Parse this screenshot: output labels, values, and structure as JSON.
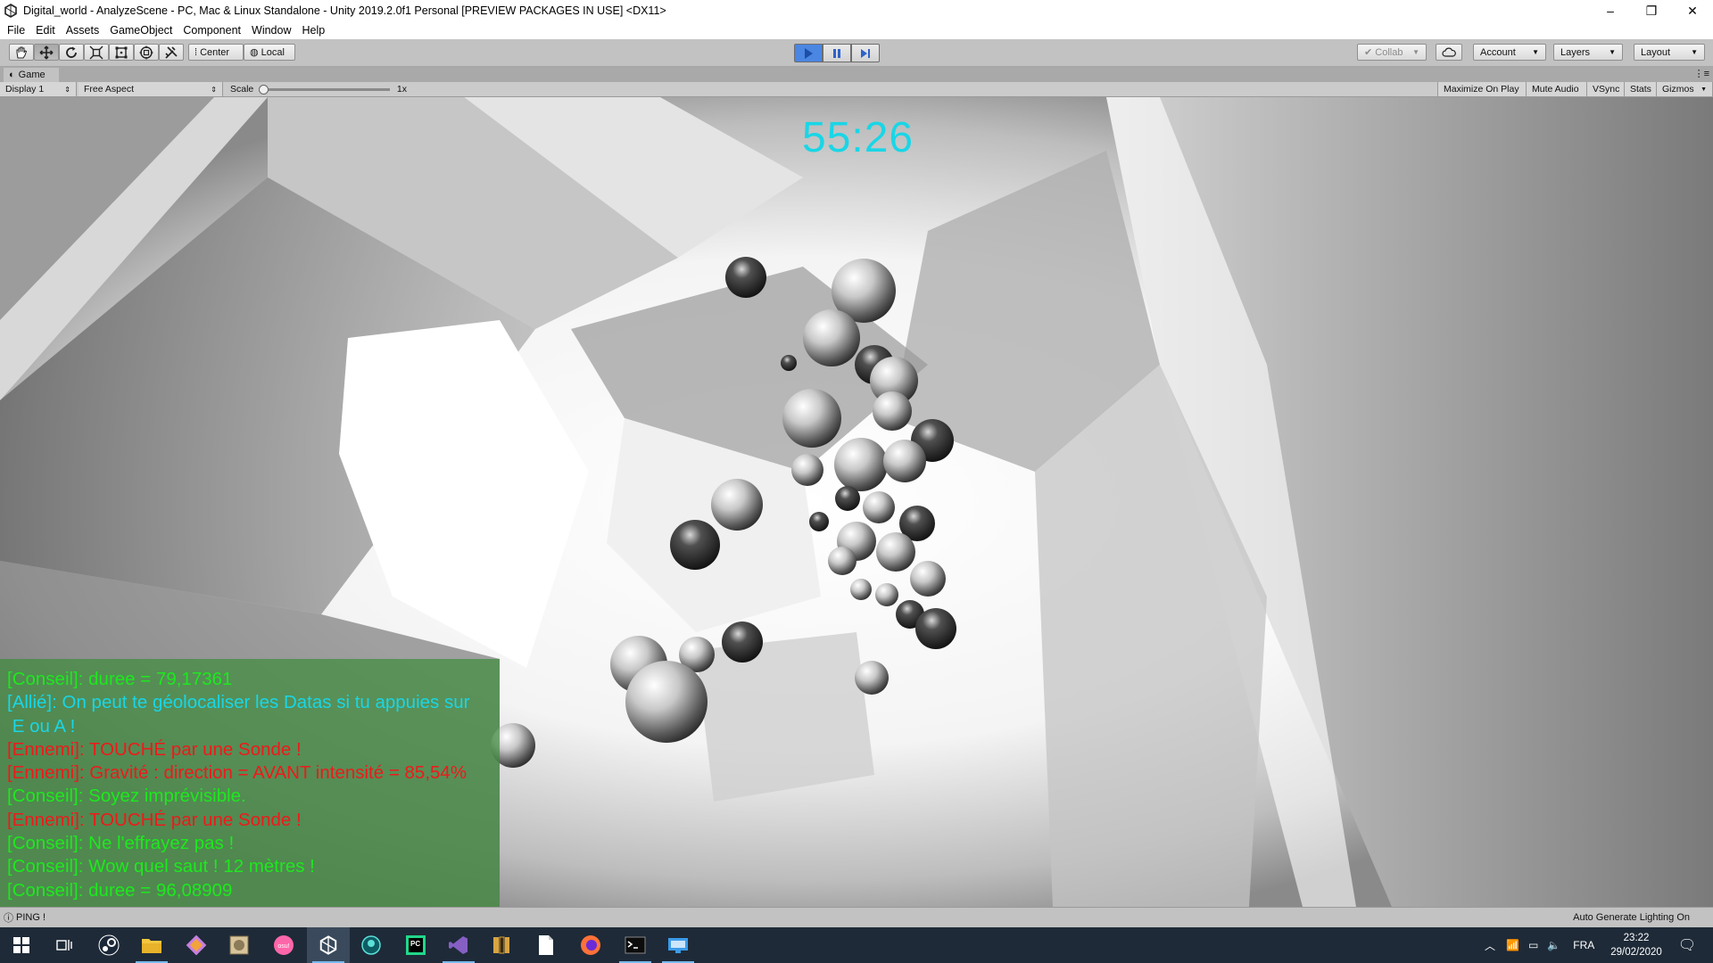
{
  "window": {
    "title": "Digital_world - AnalyzeScene - PC, Mac & Linux Standalone - Unity 2019.2.0f1 Personal [PREVIEW PACKAGES IN USE] <DX11>",
    "minimize": "–",
    "maximize": "❐",
    "close": "✕"
  },
  "menu": [
    "File",
    "Edit",
    "Assets",
    "GameObject",
    "Component",
    "Window",
    "Help"
  ],
  "toolbar": {
    "tools": [
      "hand-tool",
      "move-tool",
      "rotate-tool",
      "scale-tool",
      "rect-tool",
      "transform-tool",
      "custom-tool"
    ],
    "pivot": "Center",
    "space": "Local",
    "collab": "Collab",
    "account": "Account",
    "layers": "Layers",
    "layout": "Layout"
  },
  "game_view": {
    "tab": "Game",
    "display": "Display 1",
    "aspect": "Free Aspect",
    "scale_label": "Scale",
    "scale_value": "1x",
    "buttons": [
      "Maximize On Play",
      "Mute Audio",
      "VSync",
      "Stats",
      "Gizmos"
    ]
  },
  "hud": {
    "timer": "55:26",
    "chat": [
      {
        "text": "[Conseil]: duree = 79,17361",
        "color": "#1ee81e"
      },
      {
        "text": "[Allié]: On peut te géolocaliser les Datas si tu appuies sur",
        "color": "#19d6e6"
      },
      {
        "text": " E ou A !",
        "color": "#19d6e6"
      },
      {
        "text": "[Ennemi]: TOUCHÉ par une Sonde !",
        "color": "#ee1a1a"
      },
      {
        "text": "[Ennemi]: Gravité : direction = AVANT intensité = 85,54%",
        "color": "#ee1a1a"
      },
      {
        "text": "[Conseil]: Soyez imprévisible.",
        "color": "#1ee81e"
      },
      {
        "text": "[Ennemi]: TOUCHÉ par une Sonde !",
        "color": "#ee1a1a"
      },
      {
        "text": "[Conseil]: Ne l'effrayez pas !",
        "color": "#1ee81e"
      },
      {
        "text": "[Conseil]: Wow quel saut ! 12 mètres !",
        "color": "#1ee81e"
      },
      {
        "text": "[Conseil]: duree = 96,08909",
        "color": "#1ee81e"
      }
    ]
  },
  "status": {
    "message": "PING !",
    "right": "Auto Generate Lighting On"
  },
  "taskbar": {
    "apps": [
      "start-icon",
      "task-view-icon",
      "steam-icon",
      "file-explorer-icon",
      "git-icon",
      "image-app-icon",
      "osu-icon",
      "unity-icon",
      "gitkraken-icon",
      "pycharm-icon",
      "visual-studio-icon",
      "books-icon",
      "notepad-icon",
      "firefox-icon",
      "terminal-icon",
      "remote-icon"
    ],
    "language": "FRA",
    "time": "23:22",
    "date": "29/02/2020"
  },
  "colors": {
    "timer": "#19d6e6",
    "chat_bg": "rgba(60,140,60,0.70)",
    "play_active": "#3d7be0",
    "taskbar": "#1e2a38"
  }
}
